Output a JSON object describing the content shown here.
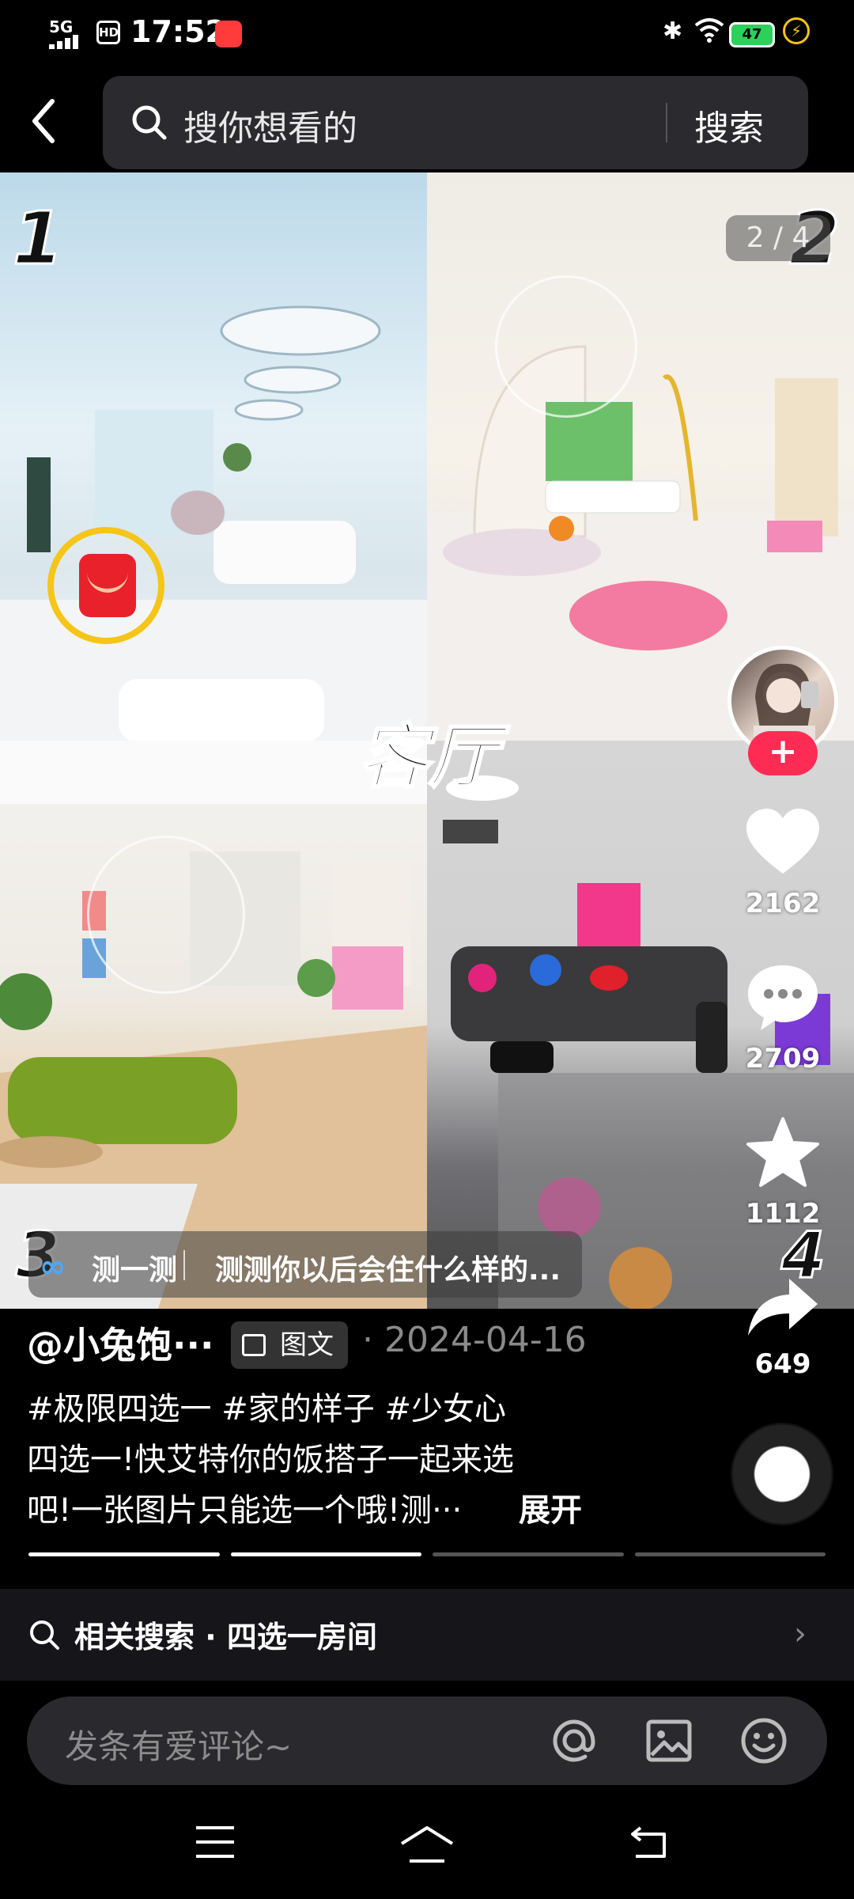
{
  "status_bar": {
    "network": "5G",
    "hd": "HD",
    "time": "17:52",
    "battery": "47"
  },
  "search": {
    "placeholder": "搜你想看的",
    "button": "搜索"
  },
  "media": {
    "page_indicator": "2 / 4",
    "numbers": [
      "1",
      "2",
      "3",
      "4"
    ],
    "room_label": "客厅",
    "quiz": {
      "title": "测一测",
      "text": "测测你以后会住什么样的..."
    }
  },
  "rail": {
    "likes": "2162",
    "comments": "2709",
    "favorites": "1112",
    "shares": "649",
    "follow_glyph": "+"
  },
  "post": {
    "author": "@小兔饱···",
    "type_tag": "图文",
    "date": "· 2024-04-16",
    "hashtags": "#极限四选一  #家的样子  #少女心",
    "desc_line1": "四选一!快艾特你的饭搭子一起来选",
    "desc_line2": "吧!一张图片只能选一个哦!测···",
    "expand": "展开"
  },
  "progress": {
    "total": 4,
    "current": 2
  },
  "related": {
    "text": "相关搜索 · 四选一房间"
  },
  "comment_bar": {
    "placeholder": "发条有爱评论~"
  },
  "colors": {
    "accent_pink": "#fe2c55",
    "quiz_blue": "#4aa8ff",
    "ring_yellow": "#f5c518"
  }
}
